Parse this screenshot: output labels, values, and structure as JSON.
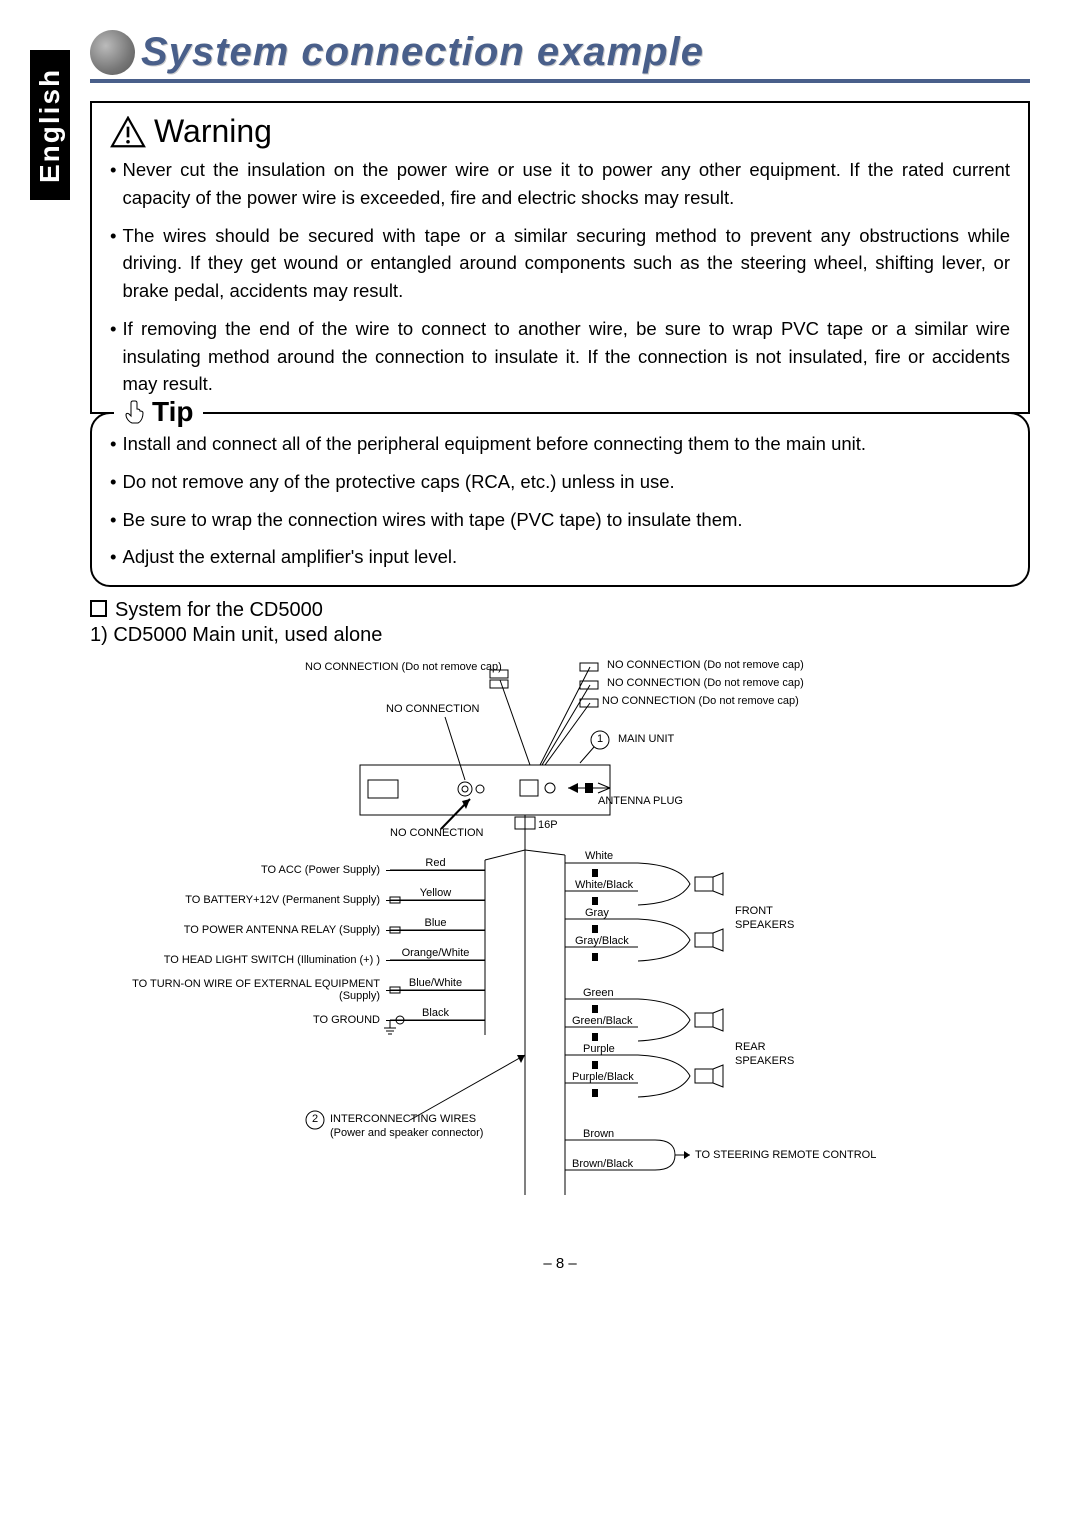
{
  "lang_tab": "English",
  "heading": "System connection example",
  "warning": {
    "title": "Warning",
    "items": [
      "Never cut the insulation on the power wire or use it to power any other equipment. If the rated current capacity of the power wire is exceeded, fire and electric shocks may result.",
      "The wires should be secured with tape or a similar securing method to prevent any obstructions while driving. If they get wound or entangled around components such as the steering wheel, shifting lever, or brake pedal, accidents may result.",
      "If removing the end of the wire to connect to another wire, be sure to wrap PVC tape or a similar wire insulating method around the connection to insulate it. If the connection is not insulated, fire or accidents may result."
    ]
  },
  "tip": {
    "title": "Tip",
    "items": [
      "Install and connect all of the peripheral equipment before connecting them to the main unit.",
      "Do not remove any of the protective caps (RCA, etc.) unless in use.",
      "Be sure to wrap the connection wires with tape (PVC tape) to insulate them.",
      "Adjust the external amplifier's input level."
    ]
  },
  "section": {
    "title": "System for the CD5000",
    "sub": "1) CD5000 Main unit, used alone"
  },
  "diagram": {
    "no_conn_cap_left": "NO CONNECTION (Do not remove cap)",
    "no_conn_cap_r1": "NO CONNECTION (Do not remove cap)",
    "no_conn_cap_r2": "NO CONNECTION (Do not remove cap)",
    "no_conn_cap_r3": "NO CONNECTION (Do not remove cap)",
    "no_conn_top": "NO CONNECTION",
    "no_conn_bottom": "NO CONNECTION",
    "main_unit_num": "1",
    "main_unit": "MAIN UNIT",
    "antenna": "ANTENNA PLUG",
    "p16": "16P",
    "front_sp": "FRONT",
    "front_sp2": "SPEAKERS",
    "rear_sp": "REAR",
    "rear_sp2": "SPEAKERS",
    "inter_num": "2",
    "inter1": "INTERCONNECTING WIRES",
    "inter2": "(Power and speaker connector)",
    "steering": "TO STEERING REMOTE CONTROL",
    "left_wires": [
      {
        "label": "TO ACC (Power Supply)",
        "color": "Red"
      },
      {
        "label": "TO BATTERY+12V (Permanent Supply)",
        "color": "Yellow"
      },
      {
        "label": "TO POWER ANTENNA RELAY (Supply)",
        "color": "Blue"
      },
      {
        "label": "TO HEAD LIGHT SWITCH (Illumination (+) )",
        "color": "Orange/White"
      },
      {
        "label": "TO TURN-ON WIRE OF EXTERNAL EQUIPMENT (Supply)",
        "color": "Blue/White"
      },
      {
        "label": "TO GROUND",
        "color": "Black"
      }
    ],
    "right_wires": [
      "White",
      "White/Black",
      "Gray",
      "Gray/Black",
      "Green",
      "Green/Black",
      "Purple",
      "Purple/Black",
      "Brown",
      "Brown/Black"
    ]
  },
  "page_number": "– 8 –"
}
